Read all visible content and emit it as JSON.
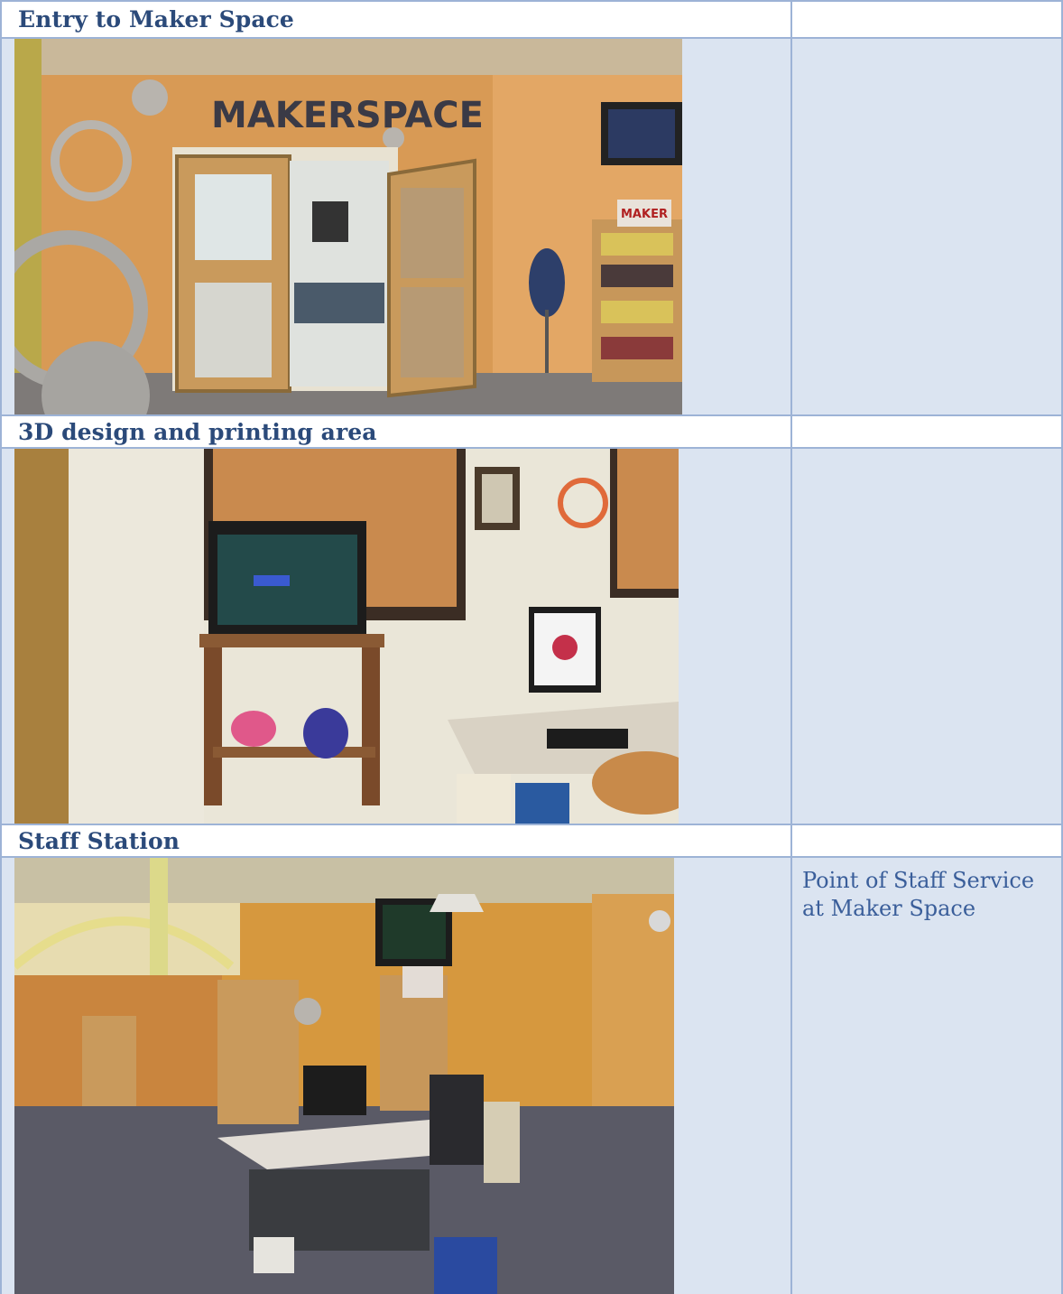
{
  "sections": [
    {
      "heading": "Entry to Maker Space",
      "photo": "maker-space-entrance-photo",
      "caption": ""
    },
    {
      "heading": "3D design and printing area",
      "photo": "3d-printing-area-photo",
      "caption": ""
    },
    {
      "heading": "Staff Station",
      "photo": "staff-station-photo",
      "caption": "Point of Staff Service at Maker Space"
    }
  ],
  "signage": {
    "maker_space_sign": "MAKERSPACE",
    "book_display_sign": "MAKER"
  },
  "colors": {
    "heading_text": "#2b4a7a",
    "caption_text": "#3a5e9a",
    "cell_fill": "#dbe4f1",
    "border": "#9db3d6"
  }
}
